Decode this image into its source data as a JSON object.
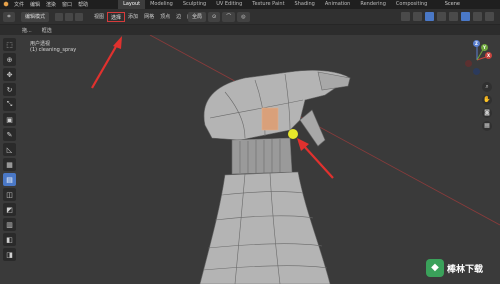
{
  "topbar": {
    "logo": "⬢",
    "menu": [
      "文件",
      "编辑",
      "渲染",
      "窗口",
      "帮助"
    ],
    "tabs": [
      "Layout",
      "Modeling",
      "Sculpting",
      "UV Editing",
      "Texture Paint",
      "Shading",
      "Animation",
      "Rendering",
      "Compositing"
    ],
    "scene_label": "Scene"
  },
  "header2": {
    "mode_label": "编辑模式",
    "menu": [
      "视图",
      "选择",
      "添加",
      "网格",
      "顶点",
      "边",
      "面",
      "UV"
    ],
    "selected_menu": "选择",
    "transform_label": "全局"
  },
  "header3": {
    "items": [
      "拖...",
      "框选"
    ]
  },
  "viewport": {
    "view_name": "用户透视",
    "object_name": "(1) cleaning_spray"
  },
  "gizmo": {
    "x_label": "X",
    "y_label": "Y",
    "z_label": "Z"
  },
  "watermark": {
    "text": "棒林下载"
  },
  "colors": {
    "arrow": "#e0312e",
    "selected_vertex": "#e8e62a",
    "active_tab": "#3d3d3d",
    "accent": "#4a78c6"
  }
}
